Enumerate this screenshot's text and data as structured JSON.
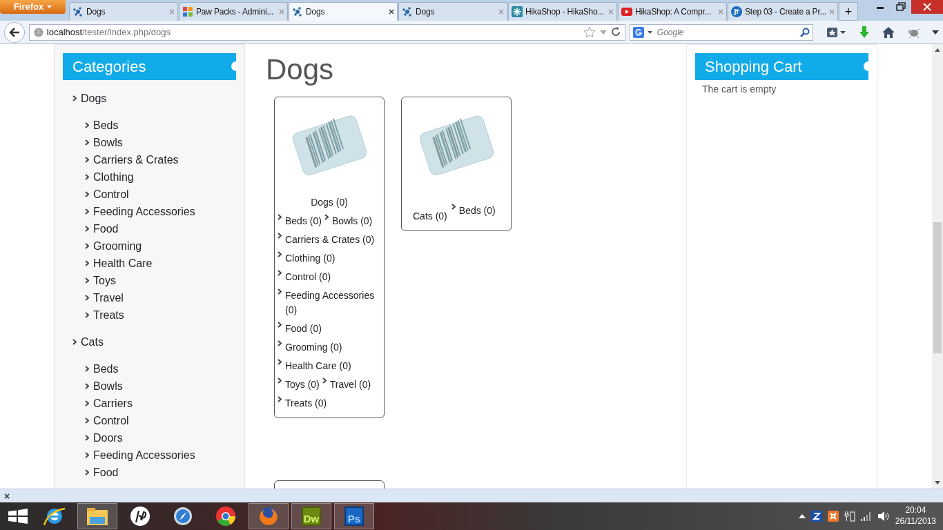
{
  "browser": {
    "menu_button": "Firefox",
    "tabs": [
      {
        "title": "Dogs",
        "kind": "dots",
        "selected": false
      },
      {
        "title": "Paw Packs - Admini...",
        "kind": "joomla",
        "selected": false
      },
      {
        "title": "Dogs",
        "kind": "dots",
        "selected": true
      },
      {
        "title": "Dogs",
        "kind": "dots",
        "selected": false
      },
      {
        "title": "HikaShop - HikaSho...",
        "kind": "hika",
        "selected": false
      },
      {
        "title": "HikaShop: A Compr...",
        "kind": "youtube",
        "selected": false
      },
      {
        "title": "Step 03 - Create a Pr...",
        "kind": "jt",
        "selected": false
      }
    ],
    "new_tab": "+",
    "address": {
      "host": "localhost",
      "path": "/tester/index.php/dogs"
    },
    "search": {
      "placeholder": "Google"
    }
  },
  "sidebar": {
    "title": "Categories",
    "groups": [
      {
        "label": "Dogs",
        "children": [
          "Beds",
          "Bowls",
          "Carriers & Crates",
          "Clothing",
          "Control",
          "Feeding Accessories",
          "Food",
          "Grooming",
          "Health Care",
          "Toys",
          "Travel",
          "Treats"
        ]
      },
      {
        "label": "Cats",
        "children": [
          "Beds",
          "Bowls",
          "Carriers",
          "Control",
          "Doors",
          "Feeding Accessories",
          "Food"
        ]
      }
    ]
  },
  "main": {
    "heading": "Dogs",
    "cards": [
      {
        "title": "Dogs (0)",
        "kind": "stacked",
        "subcategories": [
          "Beds (0)",
          "Bowls (0)",
          "Carriers & Crates (0)",
          "Clothing (0)",
          "Control (0)",
          "Feeding Accessories (0)",
          "Food (0)",
          "Grooming (0)",
          "Health Care (0)",
          "Toys (0)",
          "Travel (0)",
          "Treats (0)"
        ]
      },
      {
        "title": "Cats (0)",
        "kind": "inline",
        "subcategories": [
          "Beds (0)"
        ]
      }
    ]
  },
  "cart": {
    "title": "Shopping Cart",
    "message": "The cart is empty"
  },
  "notification_bar": {
    "close": "×"
  },
  "taskbar": {
    "apps": [
      {
        "kind": "ie",
        "selected": false
      },
      {
        "kind": "explorer",
        "selected": true
      },
      {
        "kind": "hp",
        "selected": false
      },
      {
        "kind": "safari",
        "selected": false
      },
      {
        "kind": "chrome",
        "selected": false
      },
      {
        "kind": "firefox",
        "selected": true
      },
      {
        "kind": "dw",
        "label": "Dw",
        "selected": true
      },
      {
        "kind": "ps",
        "label": "Ps",
        "selected": true
      }
    ],
    "time": "20:04",
    "date": "26/11/2013"
  }
}
